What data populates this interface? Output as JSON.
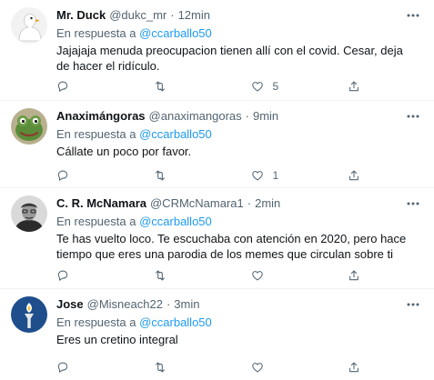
{
  "reply_prefix": "En respuesta a",
  "tweets": [
    {
      "name": "Mr. Duck",
      "handle": "@dukc_mr",
      "separator": "·",
      "time": "12min",
      "reply_to": "@ccarballo50",
      "text": "Jajajaja menuda preocupacion tienen allí con el covid. Cesar, deja de hacer el ridículo.",
      "like_count": "5",
      "avatar": "duck-avatar"
    },
    {
      "name": "Anaximángoras",
      "handle": "@anaximangoras",
      "separator": "·",
      "time": "9min",
      "reply_to": "@ccarballo50",
      "text": "Cállate un poco por favor.",
      "like_count": "1",
      "avatar": "frog-avatar"
    },
    {
      "name": "C. R. McNamara",
      "handle": "@CRMcNamara1",
      "separator": "·",
      "time": "2min",
      "reply_to": "@ccarballo50",
      "text": "Te has vuelto loco. Te escuchaba con atención en 2020, pero hace tiempo que eres una parodia de los memes que circulan sobre ti",
      "like_count": "",
      "avatar": "portrait-avatar"
    },
    {
      "name": "Jose",
      "handle": "@Misneach22",
      "separator": "·",
      "time": "3min",
      "reply_to": "@ccarballo50",
      "text": "Eres un cretino integral",
      "like_count": "",
      "avatar": "torch-avatar"
    }
  ],
  "colors": {
    "text": "#0f1419",
    "secondary": "#536471",
    "link": "#1d9bf0",
    "divider": "#eff3f4"
  }
}
